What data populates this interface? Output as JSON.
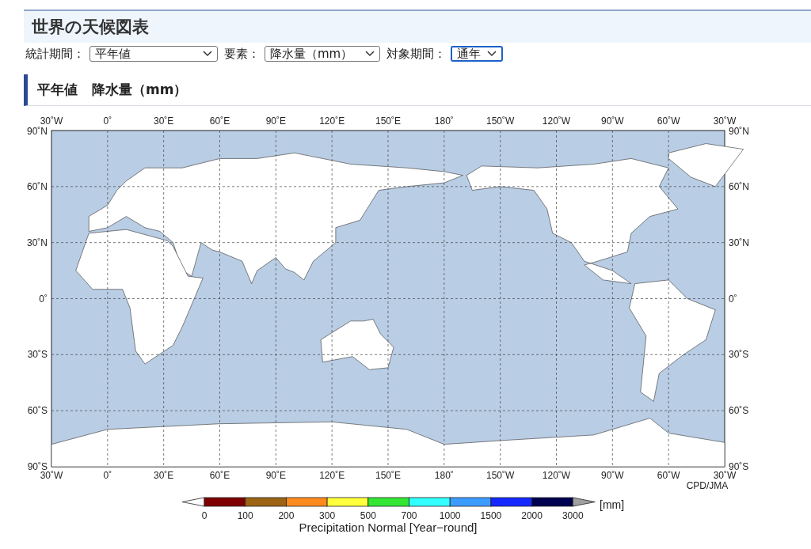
{
  "header": {
    "title": "世界の天候図表"
  },
  "filters": [
    {
      "label": "統計期間：",
      "value": "平年値",
      "focused": false
    },
    {
      "label": "要素：",
      "value": "降水量（mm）",
      "focused": false
    },
    {
      "label": "対象期間：",
      "value": "通年",
      "focused": true
    }
  ],
  "section_heading": [
    "平年値",
    "降水量（mm）"
  ],
  "map": {
    "lon_labels_top": [
      "30˚W",
      "0˚",
      "30˚E",
      "60˚E",
      "90˚E",
      "120˚E",
      "150˚E",
      "180˚",
      "150˚W",
      "120˚W",
      "90˚W",
      "60˚W",
      "30˚W"
    ],
    "lon_labels_bottom": [
      "30˚W",
      "0˚",
      "30˚E",
      "60˚E",
      "90˚E",
      "120˚E",
      "150˚E",
      "180˚",
      "150˚W",
      "120˚W",
      "90˚W",
      "60˚W",
      "30˚W"
    ],
    "lat_labels_left": [
      "90˚N",
      "60˚N",
      "30˚N",
      "0˚",
      "30˚S",
      "60˚S",
      "90˚S"
    ],
    "lat_labels_right": [
      "90˚N",
      "60˚N",
      "30˚N",
      "0˚",
      "30˚S",
      "60˚S",
      "90˚S"
    ],
    "credit": "CPD/JMA"
  },
  "legend": {
    "ticks": [
      "0",
      "100",
      "200",
      "300",
      "500",
      "700",
      "1000",
      "1500",
      "2000",
      "3000"
    ],
    "unit": "[mm]",
    "title": "Precipitation Normal [Year−round]",
    "colors": [
      {
        "color": "#ffffff"
      },
      {
        "color": "#7f0000"
      },
      {
        "color": "#9c6414"
      },
      {
        "color": "#ff8a1e"
      },
      {
        "color": "#ffff3c"
      },
      {
        "color": "#32e632"
      },
      {
        "color": "#32ffff"
      },
      {
        "color": "#3c9bff"
      },
      {
        "color": "#1428ff"
      },
      {
        "color": "#000050"
      },
      {
        "color": "#a0a0a0"
      }
    ]
  }
}
